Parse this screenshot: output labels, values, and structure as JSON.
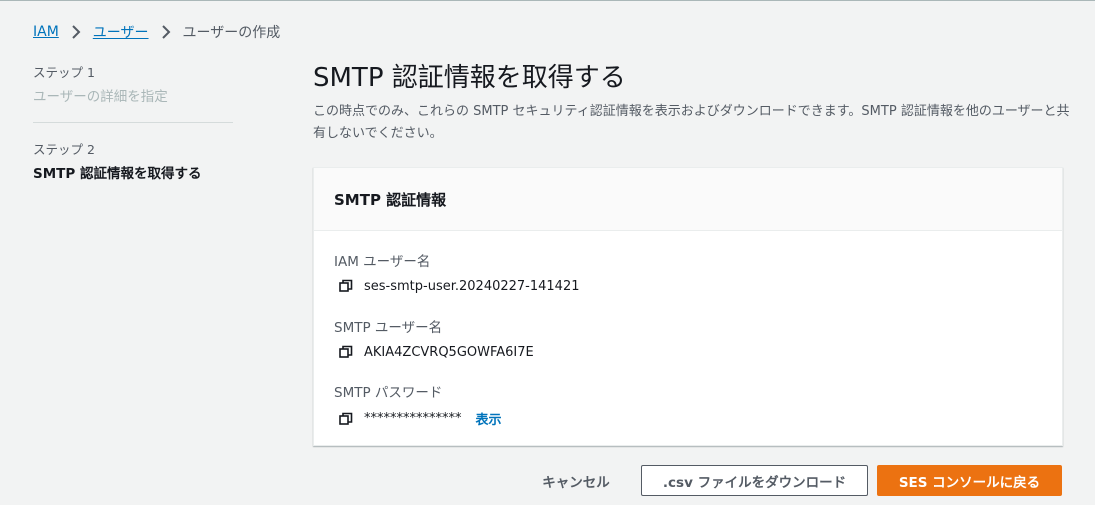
{
  "breadcrumb": {
    "items": [
      "IAM",
      "ユーザー",
      "ユーザーの作成"
    ]
  },
  "steps": [
    {
      "label": "ステップ 1",
      "title": "ユーザーの詳細を指定",
      "state": "completed"
    },
    {
      "label": "ステップ 2",
      "title": "SMTP 認証情報を取得する",
      "state": "active"
    }
  ],
  "page": {
    "title": "SMTP 認証情報を取得する",
    "description": "この時点でのみ、これらの SMTP セキュリティ認証情報を表示およびダウンロードできます。SMTP 認証情報を他のユーザーと共有しないでください。"
  },
  "panel": {
    "title": "SMTP 認証情報",
    "fields": [
      {
        "label": "IAM ユーザー名",
        "value": "ses-smtp-user.20240227-141421"
      },
      {
        "label": "SMTP ユーザー名",
        "value": "AKIA4ZCVRQ5GOWFA6I7E"
      },
      {
        "label": "SMTP パスワード",
        "value": "***************",
        "show_label": "表示"
      }
    ]
  },
  "footer": {
    "cancel_label": "キャンセル",
    "download_label": ".csv ファイルをダウンロード",
    "primary_label": "SES コンソールに戻る"
  },
  "colors": {
    "link": "#0073bb",
    "primary": "#ec7211",
    "background": "#f2f3f3",
    "text": "#16191f",
    "secondary_text": "#545b64"
  },
  "icons": {
    "breadcrumb_separator": "chevron-right-icon",
    "copy": "copy-icon"
  }
}
